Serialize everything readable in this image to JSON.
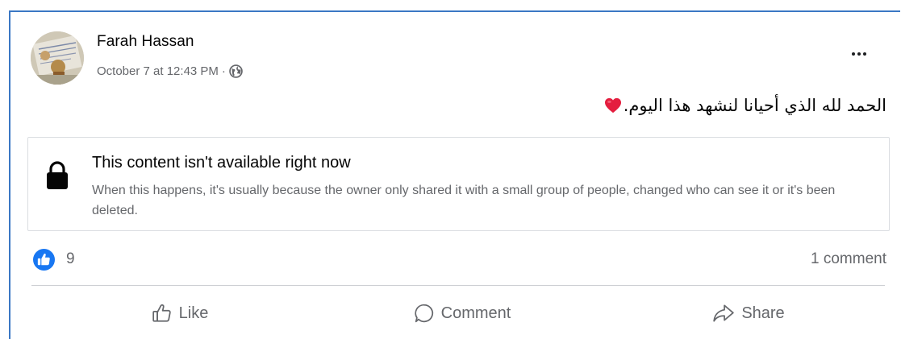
{
  "post": {
    "author": "Farah Hassan",
    "timestamp": "October 7 at 12:43 PM",
    "separator": "·",
    "privacy_icon": "globe-icon",
    "text": "الحمد لله الذي أحيانا لنشهد هذا اليوم.",
    "text_emoji": "heart-icon"
  },
  "attachment": {
    "title": "This content isn't available right now",
    "body": "When this happens, it's usually because the owner only shared it with a small group of people, changed who can see it or it's been deleted.",
    "icon": "lock-icon"
  },
  "reactions": {
    "icon": "like-reaction-icon",
    "count": "9",
    "comments": "1 comment"
  },
  "actions": {
    "like": "Like",
    "comment": "Comment",
    "share": "Share"
  },
  "colors": {
    "accent": "#1877f2",
    "secondary_text": "#65676b",
    "heart": "#e41e3f"
  }
}
